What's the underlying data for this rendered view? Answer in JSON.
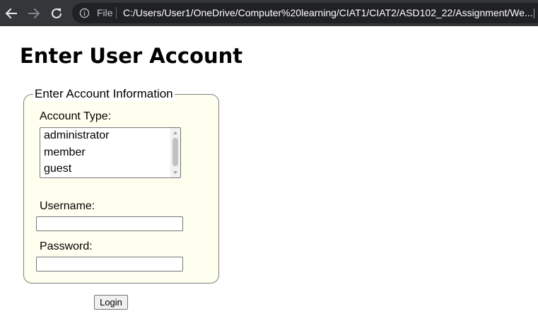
{
  "browser": {
    "file_label": "File",
    "url": "C:/Users/User1/OneDrive/Computer%20learning/CIAT1/CIAT2/ASD102_22/Assignment/We...",
    "icons": [
      "back-arrow-icon",
      "forward-arrow-icon",
      "reload-icon",
      "info-icon"
    ]
  },
  "page": {
    "title": "Enter User Account"
  },
  "form": {
    "legend": "Enter Account Information",
    "account_type_label": "Account Type:",
    "account_types": [
      "administrator",
      "member",
      "guest"
    ],
    "username_label": "Username:",
    "username_value": "",
    "password_label": "Password:",
    "password_value": "",
    "login_label": "Login"
  },
  "colors": {
    "toolbar": "#35363a",
    "omnibox": "#202124",
    "fieldset_bg": "#fffff0",
    "fieldset_border": "#808080"
  }
}
